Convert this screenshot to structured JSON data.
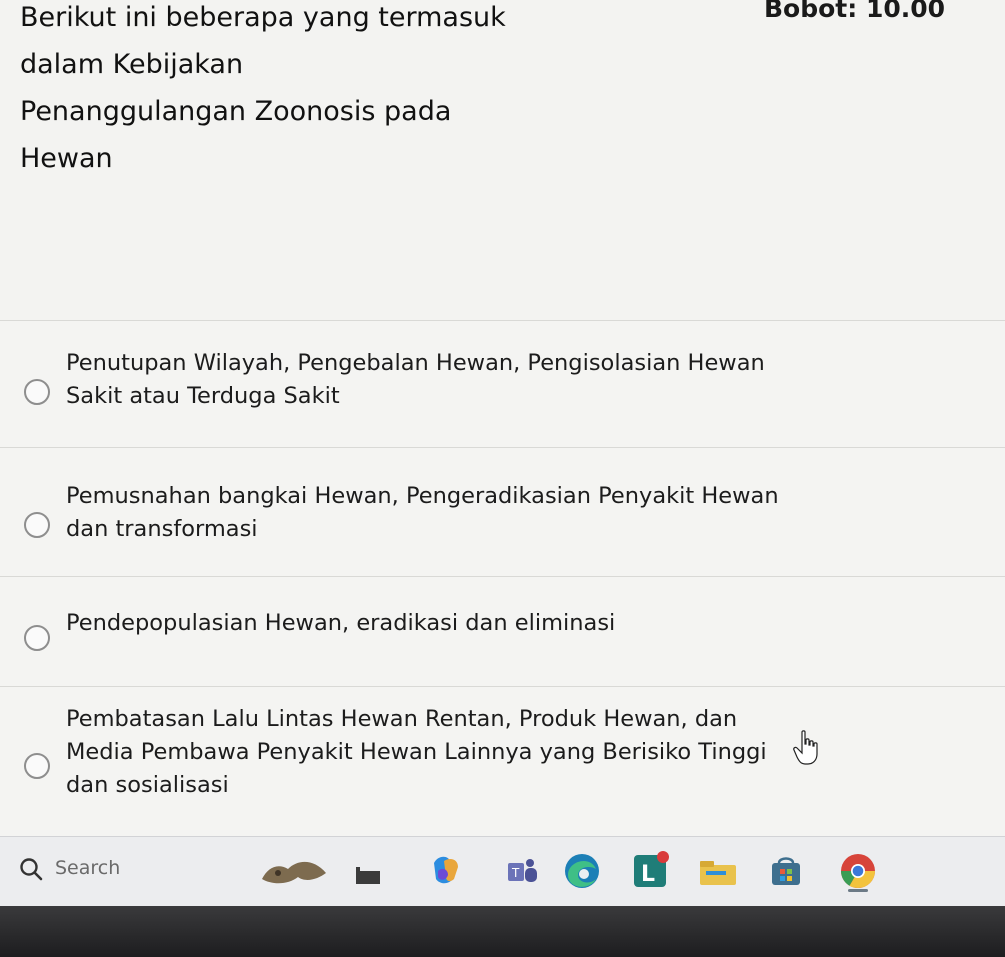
{
  "question": {
    "text_lines": [
      "Berikut ini beberapa yang termasuk",
      "dalam Kebijakan",
      "Penanggulangan Zoonosis pada",
      "Hewan"
    ],
    "score_label": "Bobot: 10.00"
  },
  "options": [
    {
      "lines": [
        "Penutupan Wilayah, Pengebalan Hewan, Pengisolasian Hewan",
        "Sakit atau Terduga Sakit"
      ]
    },
    {
      "lines": [
        "Pemusnahan bangkai Hewan, Pengeradikasian Penyakit Hewan",
        "dan transformasi"
      ]
    },
    {
      "lines": [
        "Pendepopulasian Hewan, eradikasi dan eliminasi"
      ]
    },
    {
      "lines": [
        "Pembatasan Lalu Lintas Hewan Rentan, Produk Hewan, dan",
        "Media Pembawa Penyakit Hewan Lainnya yang Berisiko Tinggi",
        "dan sosialisasi"
      ]
    }
  ],
  "taskbar": {
    "search_placeholder": "Search",
    "apps": [
      "widgets-icon",
      "file-explorer-icon",
      "copilot-icon",
      "teams-icon",
      "edge-icon",
      "learning-app-icon",
      "folder-icon",
      "store-icon",
      "chrome-icon"
    ]
  }
}
